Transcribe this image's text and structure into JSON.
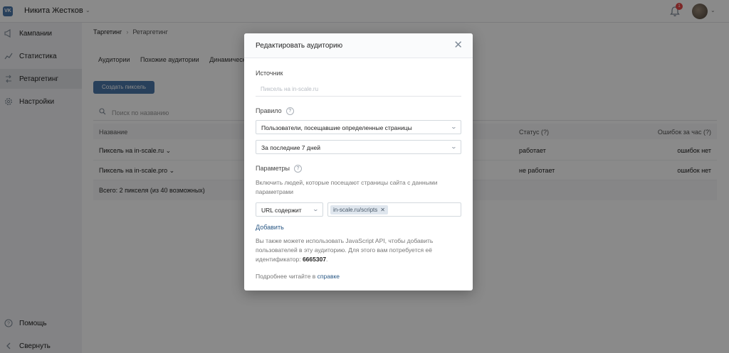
{
  "topbar": {
    "logo": "VK",
    "user_name": "Никита Жестков",
    "user_caret": "⌄",
    "notif_count": "1"
  },
  "sidebar": {
    "items": [
      {
        "label": "Кампании",
        "icon": "megaphone-icon"
      },
      {
        "label": "Статистика",
        "icon": "chart-icon"
      },
      {
        "label": "Ретаргетинг",
        "icon": "retarget-icon"
      },
      {
        "label": "Настройки",
        "icon": "gear-icon"
      }
    ],
    "help": "Помощь",
    "collapse": "Свернуть"
  },
  "main": {
    "breadcrumb": {
      "root": "Таргетинг",
      "current": "Ретаргетинг"
    },
    "tabs": [
      "Аудитории",
      "Похожие аудитории",
      "Динамическ..."
    ],
    "create_button": "Создать пиксель",
    "search_placeholder": "Поиск по названию",
    "table": {
      "headers": {
        "name": "Название",
        "status": "Статус (?)",
        "errors": "Ошибок за час (?)"
      },
      "rows": [
        {
          "name": "Пиксель на in-scale.ru ⌄",
          "status": "работает",
          "errors": "ошибок нет"
        },
        {
          "name": "Пиксель на in-scale.pro ⌄",
          "status": "не работает",
          "errors": "ошибок нет"
        }
      ],
      "footer": "Всего: 2 пикселя (из 40 возможных)"
    }
  },
  "modal": {
    "title": "Редактировать аудиторию",
    "source_label": "Источник",
    "source_value": "Пиксель на in-scale.ru",
    "rule_label": "Правило",
    "rule_select": "Пользователи, посещавшие определенные страницы",
    "period_select": "За последние 7 дней",
    "params_label": "Параметры",
    "params_desc": "Включить людей, которые посещают страницы сайта с данными параметрами",
    "condition_select": "URL содержит",
    "tag_value": "in-scale.ru/scripts",
    "add_link": "Добавить",
    "api_text_prefix": "Вы также можете использовать JavaScript API, чтобы добавить пользователей в эту аудиторию. Для этого вам потребуется её идентификатор:",
    "api_id": "6665307",
    "api_suffix": ".",
    "more_prefix": "Подробнее читайте в",
    "more_link": "справке",
    "help_glyph": "?",
    "close_glyph": "✕",
    "chevron_glyph": "⌄"
  }
}
